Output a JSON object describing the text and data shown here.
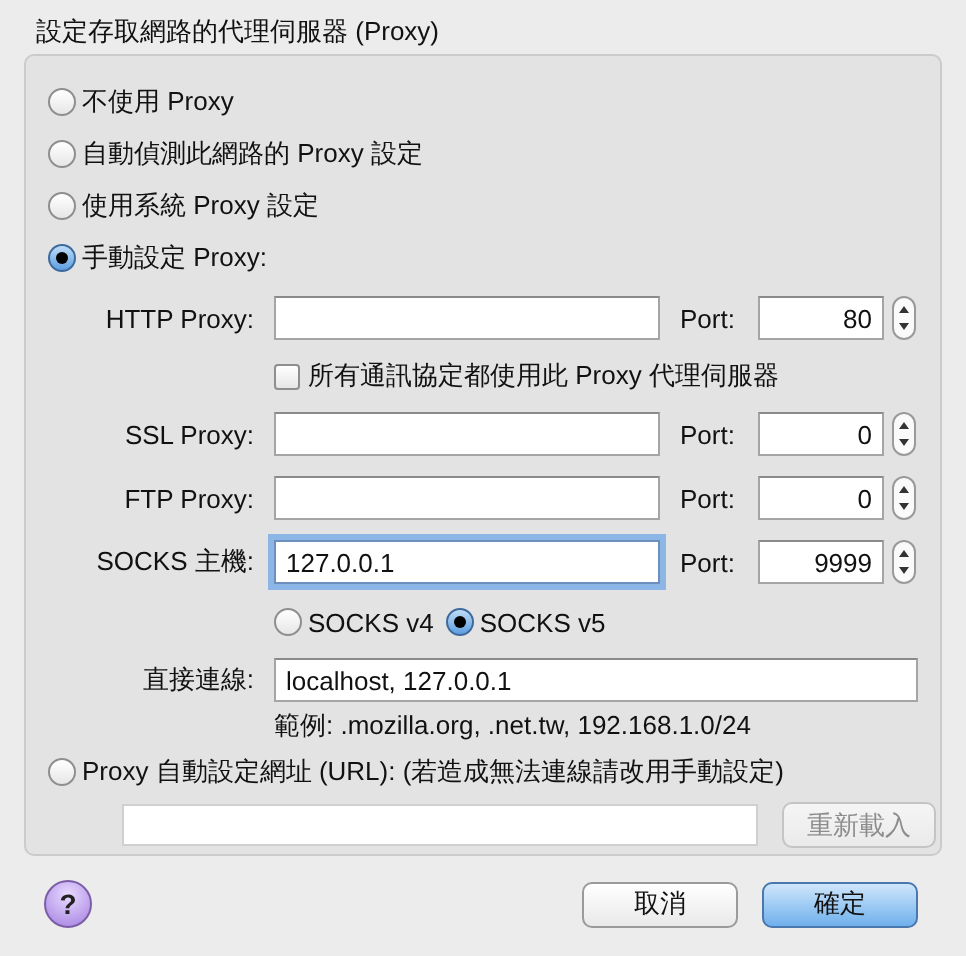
{
  "section_title": "設定存取網路的代理伺服器 (Proxy)",
  "modes": [
    {
      "label": "不使用 Proxy",
      "selected": false
    },
    {
      "label": "自動偵測此網路的 Proxy 設定",
      "selected": false
    },
    {
      "label": "使用系統 Proxy 設定",
      "selected": false
    },
    {
      "label": "手動設定 Proxy:",
      "selected": true
    }
  ],
  "proxies": [
    {
      "label": "HTTP Proxy:",
      "port_label": "Port:",
      "port": "80",
      "focused": false
    },
    {
      "label": "SSL Proxy:",
      "port_label": "Port:",
      "port": "0",
      "focused": false
    },
    {
      "label": "FTP Proxy:",
      "port_label": "Port:",
      "port": "0",
      "focused": false
    },
    {
      "label": "SOCKS 主機:",
      "value": "127.0.0.1",
      "port_label": "Port:",
      "port": "9999",
      "focused": true
    }
  ],
  "share_all": {
    "label": "所有通訊協定都使用此 Proxy 代理伺服器",
    "checked": false
  },
  "socks_versions": [
    {
      "label": "SOCKS v4",
      "selected": false
    },
    {
      "label": "SOCKS v5",
      "selected": true
    }
  ],
  "no_proxy": {
    "label": "直接連線:",
    "value": "localhost, 127.0.0.1"
  },
  "example": "範例: .mozilla.org, .net.tw, 192.168.1.0/24",
  "auto_config": {
    "label": "Proxy 自動設定網址 (URL): (若造成無法連線請改用手動設定)",
    "selected": false
  },
  "reload_button": {
    "label": "重新載入",
    "disabled": true
  },
  "help": "?",
  "buttons": [
    {
      "label": "取消",
      "default": false
    },
    {
      "label": "確定",
      "default": true
    }
  ]
}
